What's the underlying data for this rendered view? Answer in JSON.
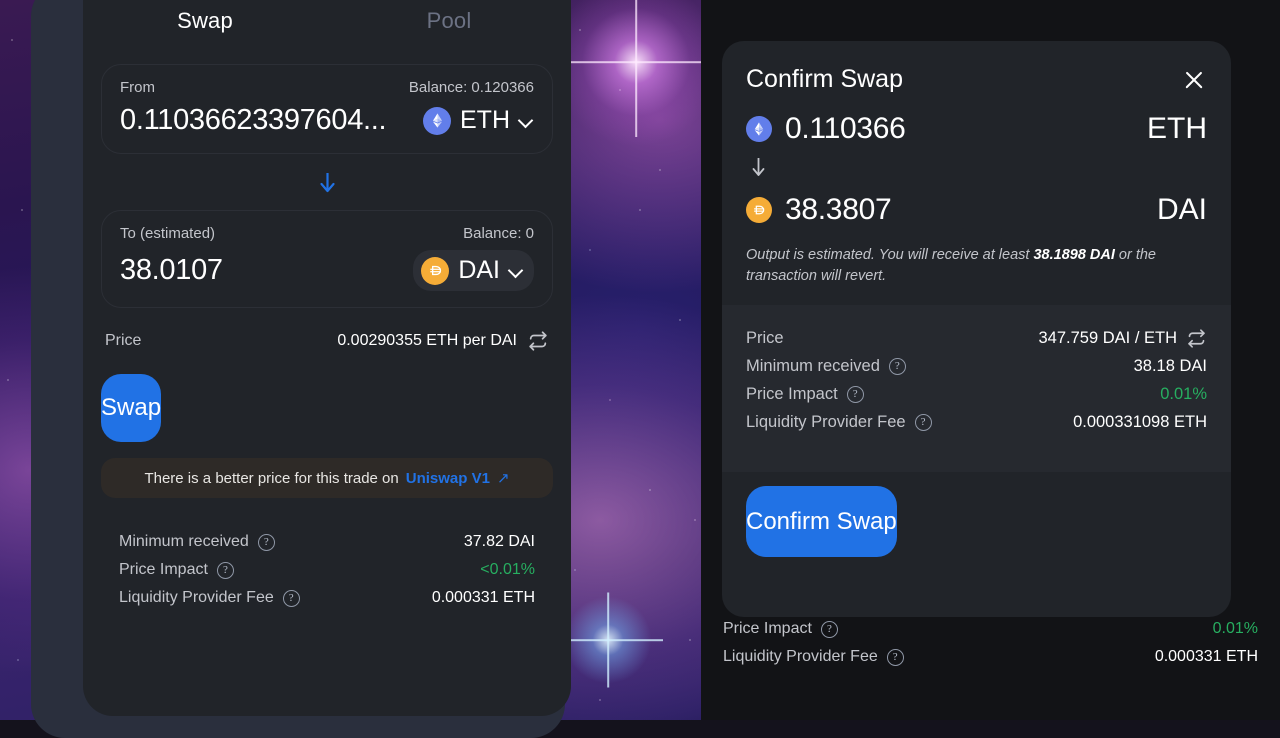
{
  "background": {
    "description": "purple-blue nebula starfield",
    "colors": {
      "nebula_purple": "#3a1a52",
      "nebula_blue": "#241a62",
      "star": "#ffffff"
    }
  },
  "theme": {
    "accent_blue": "#2172e5",
    "card_bg": "#212429",
    "panel_bg": "#2a2f3d",
    "text_primary": "#ffffff",
    "text_muted": "#c3c5cb",
    "green": "#27ae60",
    "eth_color": "#627eea",
    "dai_color": "#f5ac37"
  },
  "swap_panel": {
    "tabs": [
      {
        "label": "Swap",
        "active": true
      },
      {
        "label": "Pool",
        "active": false
      }
    ],
    "from": {
      "label": "From",
      "balance": "Balance: 0.120366",
      "amount": "0.11036623397604...",
      "token": "ETH",
      "token_icon": "eth-coin-icon"
    },
    "arrow_icon": "arrow-down-icon",
    "to": {
      "label": "To (estimated)",
      "balance": "Balance: 0",
      "amount": "38.0107",
      "token": "DAI",
      "token_icon": "dai-coin-icon"
    },
    "price": {
      "label": "Price",
      "value": "0.00290355 ETH per DAI",
      "toggle_icon": "swap-rate-icon"
    },
    "swap_button": "Swap",
    "better_price_banner": {
      "text": "There is a better price for this trade on",
      "link": "Uniswap V1",
      "external_icon": "external-link-arrow-icon"
    },
    "details": [
      {
        "label": "Minimum received",
        "help": "?",
        "value": "37.82 DAI",
        "green": false
      },
      {
        "label": "Price Impact",
        "help": "?",
        "value": "<0.01%",
        "green": true
      },
      {
        "label": "Liquidity Provider Fee",
        "help": "?",
        "value": "0.000331 ETH",
        "green": false
      }
    ]
  },
  "confirm_modal": {
    "title": "Confirm Swap",
    "close_icon": "close-icon",
    "from": {
      "amount": "0.110366",
      "token": "ETH",
      "token_icon": "eth-coin-icon"
    },
    "arrow_icon": "arrow-down-icon",
    "to": {
      "amount": "38.3807",
      "token": "DAI",
      "token_icon": "dai-coin-icon"
    },
    "note": {
      "prefix": "Output is estimated. You will receive at least ",
      "bold": "38.1898 DAI",
      "suffix": " or the transaction will revert."
    },
    "details": [
      {
        "label": "Price",
        "help": null,
        "value": "347.759 DAI / ETH",
        "icon": "swap-rate-icon",
        "green": false
      },
      {
        "label": "Minimum received",
        "help": "?",
        "value": "38.18 DAI",
        "green": false
      },
      {
        "label": "Price Impact",
        "help": "?",
        "value": "0.01%",
        "green": true
      },
      {
        "label": "Liquidity Provider Fee",
        "help": "?",
        "value": "0.000331098 ETH",
        "green": false
      }
    ],
    "confirm_button": "Confirm Swap"
  },
  "background_panel_details": [
    {
      "label": "Price Impact",
      "help": "?",
      "value": "0.01%",
      "green": true
    },
    {
      "label": "Liquidity Provider Fee",
      "help": "?",
      "value": "0.000331 ETH",
      "green": false
    }
  ]
}
